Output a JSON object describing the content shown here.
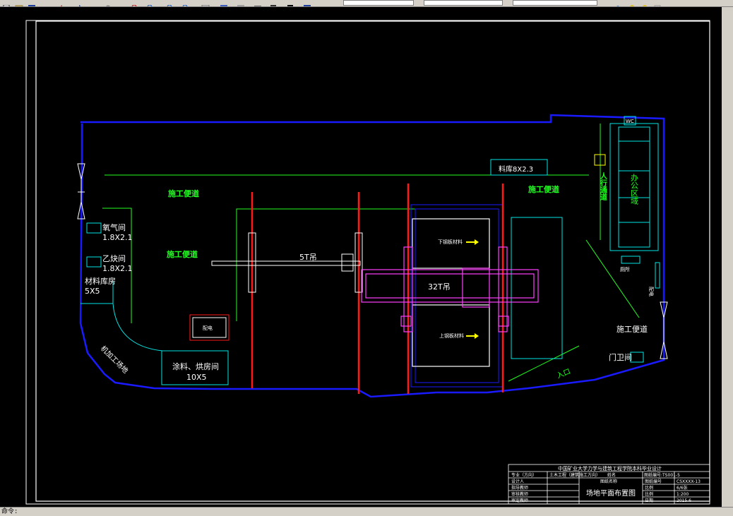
{
  "window": {
    "command_prompt": "命令:"
  },
  "toolbar": {
    "buttons": [
      "new-icon",
      "open-icon",
      "save-icon",
      "print-icon",
      "undo-icon",
      "redo-icon",
      "pan-icon",
      "zoom-realtime-icon",
      "zoom-window-icon",
      "zoom-previous-icon",
      "properties-icon",
      "design-center-icon",
      "tool-palettes-icon",
      "sheet-set-icon",
      "markup-icon",
      "calculator-icon",
      "help-icon"
    ],
    "colors": {
      "face": "#d4d0c8",
      "shadow": "#808080"
    }
  },
  "drawing": {
    "colors": {
      "background": "#000000",
      "frame": "#ffffff",
      "site_boundary": "#1a1aff",
      "road": "#22ff22",
      "crane_track": "#ff1a1a",
      "crane": "#ff40ff",
      "cyan": "#00e5e5",
      "text": "#ffffff",
      "yellow": "#ffff00"
    },
    "labels": {
      "road_top_left": "施工便道",
      "road_mid_left": "施工便道",
      "road_top_right": "施工便道",
      "road_bottom_right": "施工便道",
      "oxygen_room": "氧气间",
      "oxygen_size": "1.8X2.1",
      "acetylene_room": "乙炔间",
      "acetylene_size": "1.8X2.1",
      "material_store": "材料库房",
      "material_size": "5X5",
      "machining_area": "机加工场地",
      "paint_room": "涂料、烘房间",
      "paint_size": "10X5",
      "small_box": "配电",
      "crane_5t": "5T吊",
      "crane_32t": "32T吊",
      "steel_upper": "下钢板材料",
      "steel_lower": "上钢板材料",
      "material_shed": "料库8X2.3",
      "pedestrian_path": "人行通道",
      "office": "办公区域",
      "top_right_tag": "WC",
      "small_label_right": "厕所",
      "guard_room": "门卫间",
      "entrance": "入口",
      "side_label": "配电"
    },
    "title_block": {
      "school": "中国矿业大学力学与建筑工程学院本科毕业设计",
      "row1": [
        "专业（方向）",
        "土木工程（建筑施工方向）",
        "姓名",
        "图纸编号:TS001-5"
      ],
      "row2": [
        "设计人",
        "",
        "图纸名称",
        "图纸编号",
        "CSXXXX-13"
      ],
      "row3": [
        "指导教师",
        "",
        "比例",
        "6/6张"
      ],
      "row4": [
        "审核教师",
        "",
        "比例",
        "1:200"
      ],
      "row5": [
        "审定教师",
        "",
        "日期",
        "2015.6"
      ],
      "drawing_title": "场地平面布置图"
    }
  }
}
